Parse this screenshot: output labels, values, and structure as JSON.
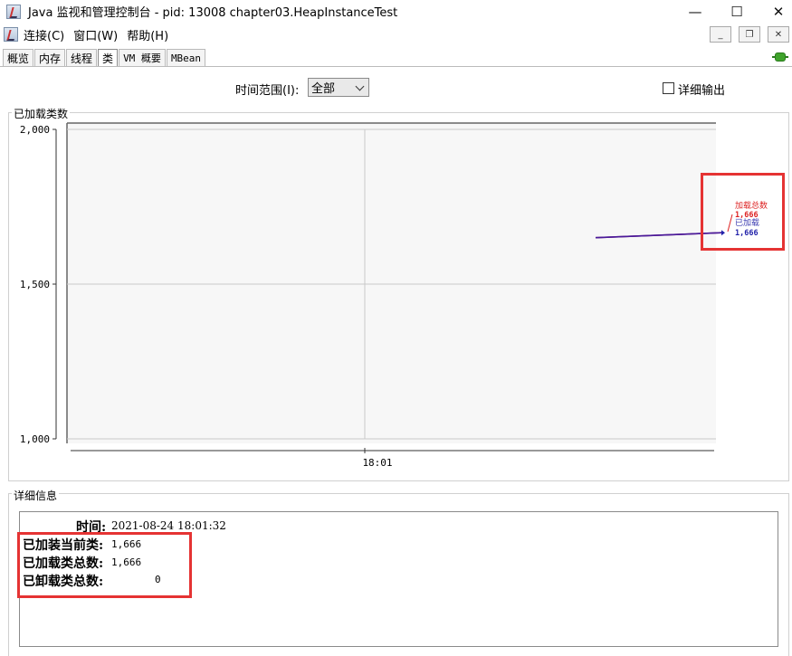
{
  "window": {
    "title": "Java 监视和管理控制台 - pid: 13008 chapter03.HeapInstanceTest",
    "minimize_glyph": "—",
    "maximize_glyph": "☐",
    "close_glyph": "✕"
  },
  "menu": {
    "items": [
      "连接(C)",
      "窗口(W)",
      "帮助(H)"
    ],
    "mdi_minimize": "_",
    "mdi_restore": "❐",
    "mdi_close": "✕"
  },
  "tabs": [
    {
      "label": "概览",
      "active": false
    },
    {
      "label": "内存",
      "active": false
    },
    {
      "label": "线程",
      "active": false
    },
    {
      "label": "类",
      "active": true
    },
    {
      "label": "VM 概要",
      "active": false
    },
    {
      "label": "MBean",
      "active": false
    }
  ],
  "controls": {
    "time_range_label": "时间范围(I):",
    "time_range_value": "全部",
    "detail_output_label": "详细输出",
    "detail_output_checked": false
  },
  "chart_panel": {
    "title": "已加载类数"
  },
  "chart_data": {
    "type": "line",
    "y_ticks": [
      "2,000",
      "1,500",
      "1,000"
    ],
    "y_tick_values": [
      2000,
      1500,
      1000
    ],
    "ylim": [
      1000,
      2000
    ],
    "x_ticks": [
      "18:01"
    ],
    "series": [
      {
        "name": "加载总数",
        "values": [
          1650,
          1666
        ],
        "last_label": "1,666",
        "color": "#dd2222"
      },
      {
        "name": "已加载",
        "values": [
          1650,
          1666
        ],
        "last_label": "1,666",
        "color": "#2222aa"
      }
    ]
  },
  "details": {
    "title": "详细信息",
    "time_label": "时间:",
    "time_value": "2021-08-24 18:01:32",
    "loaded_current_label": "已加装当前类:",
    "loaded_current_value": "1,666",
    "loaded_total_label": "已加载类总数:",
    "loaded_total_value": "1,666",
    "unloaded_total_label": "已卸载类总数:",
    "unloaded_total_value": "0"
  }
}
